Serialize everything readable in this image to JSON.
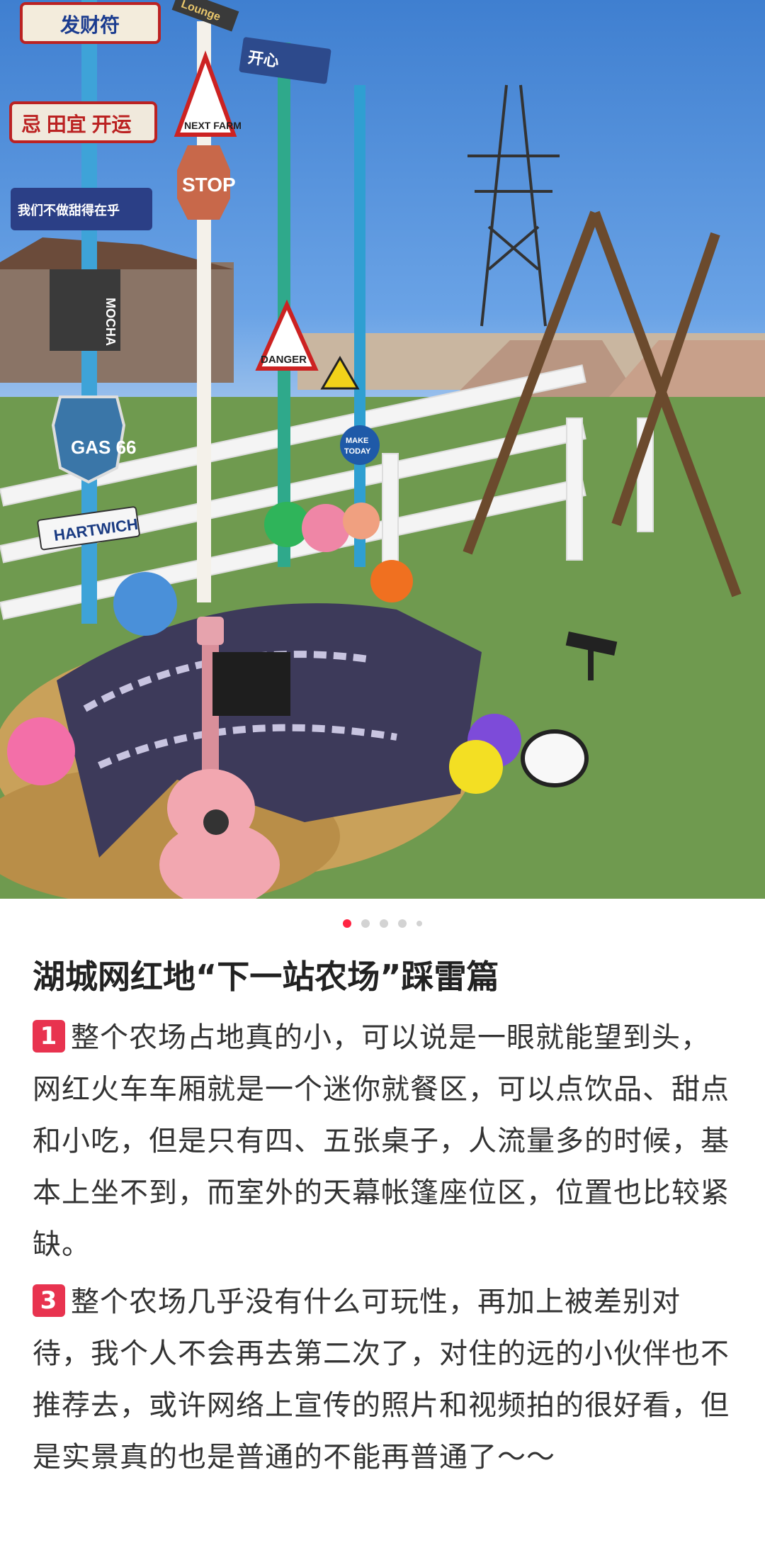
{
  "image": {
    "signs": [
      "发财符",
      "忌 田宜 开运",
      "我们不做甜得在乎",
      "NEXT FARM",
      "STOP",
      "开心",
      "DANGER",
      "MOCHA",
      "HARTWICH",
      "GAS 66",
      "MAKE TODAY",
      "Lounge"
    ]
  },
  "carousel": {
    "count": 5,
    "active": 0
  },
  "post": {
    "title": "湖城网红地“下一站农场”踩雷篇",
    "paragraphs": [
      {
        "badge": "1",
        "text": "整个农场占地真的小，可以说是一眼就能望到头，网红火车车厢就是一个迷你就餐区，可以点饮品、甜点和小吃，但是只有四、五张桌子，人流量多的时候，基本上坐不到，而室外的天幕帐篷座位区，位置也比较紧缺。"
      },
      {
        "badge": "3",
        "text": "整个农场几乎没有什么可玩性，再加上被差别对待，我个人不会再去第二次了，对住的远的小伙伴也不推荐去，或许网络上宣传的照片和视频拍的很好看，但是实景真的也是普通的不能再普通了～～"
      }
    ]
  },
  "colors": {
    "accent": "#ff2442",
    "badge": "#e8334f"
  }
}
